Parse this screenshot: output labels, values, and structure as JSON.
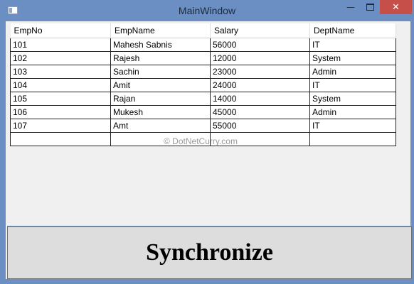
{
  "window": {
    "title": "MainWindow"
  },
  "titlebar": {
    "icon": "window-icon",
    "controls": {
      "minimize": "—",
      "close": "✕"
    }
  },
  "grid": {
    "columns": [
      "EmpNo",
      "EmpName",
      "Salary",
      "DeptName"
    ],
    "rows": [
      [
        "101",
        "Mahesh Sabnis",
        "56000",
        "IT"
      ],
      [
        "102",
        "Rajesh",
        "12000",
        "System"
      ],
      [
        "103",
        "Sachin",
        "23000",
        "Admin"
      ],
      [
        "104",
        "Amit",
        "24000",
        "IT"
      ],
      [
        "105",
        "Rajan",
        "14000",
        "System"
      ],
      [
        "106",
        "Mukesh",
        "45000",
        "Admin"
      ],
      [
        "107",
        "Amt",
        "55000",
        "IT"
      ],
      [
        "",
        "",
        "",
        ""
      ]
    ]
  },
  "watermark": "© DotNetCurry.com",
  "sync_button": {
    "label": "Synchronize"
  },
  "colors": {
    "titlebar": "#6b8fc2",
    "close": "#c74f4a",
    "client": "#f0f0f0"
  }
}
